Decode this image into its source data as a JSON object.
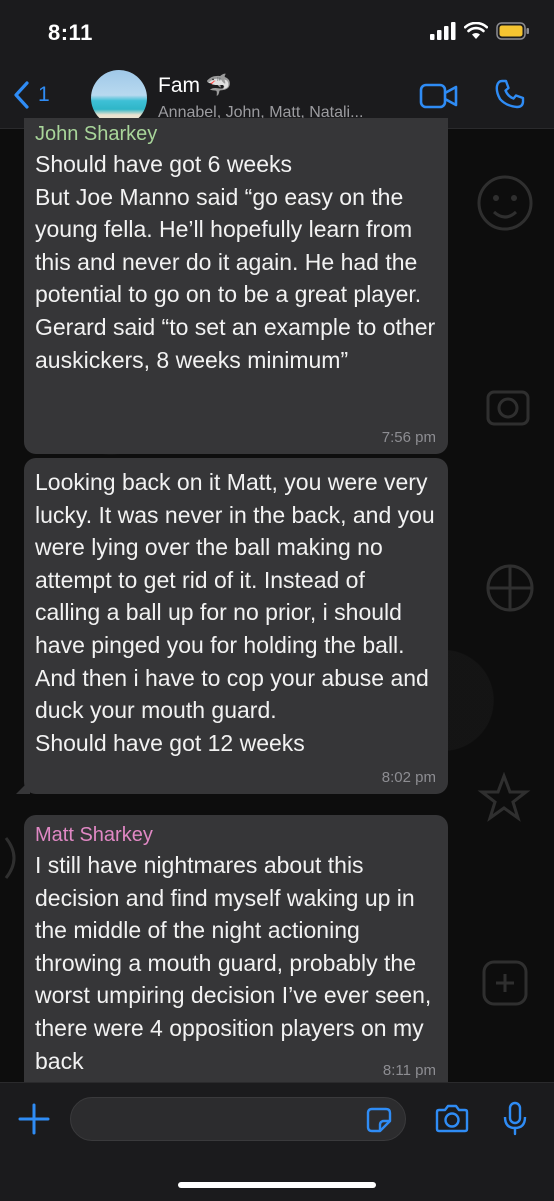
{
  "status_bar": {
    "time": "8:11"
  },
  "header": {
    "back_count": "1",
    "title": "Fam 🦈",
    "participants": "Annabel, John, Matt, Natali..."
  },
  "messages": [
    {
      "sender": "John Sharkey",
      "sender_color": "#a8d59a",
      "text": "Should have got 6 weeks\nBut Joe Manno said “go easy on the young fella. He’ll hopefully learn from this and never do it again. He had the potential to go on to be a great player.\nGerard said “to set an example to other auskickers, 8 weeks minimum”",
      "time": "7:56 pm"
    },
    {
      "sender": "",
      "text": "Looking back on it Matt, you were very lucky. It was never in the back, and you were lying over the ball making no attempt to get rid of it. Instead of calling a ball up for no prior, i should have pinged you for holding the ball. And then i have to cop your abuse and duck your mouth guard.\nShould have got 12 weeks",
      "time": "8:02 pm"
    },
    {
      "sender": "Matt Sharkey",
      "sender_color": "#e088c4",
      "text": "I still have nightmares about this decision and find myself waking up in the middle of the night actioning throwing a mouth guard, probably the worst umpiring decision I’ve ever seen, there were 4 opposition players on my back",
      "time": "8:11 pm"
    }
  ],
  "input": {
    "placeholder": ""
  },
  "colors": {
    "accent": "#2f8cf5",
    "bubble": "#363638",
    "background": "#0b0b0b"
  }
}
